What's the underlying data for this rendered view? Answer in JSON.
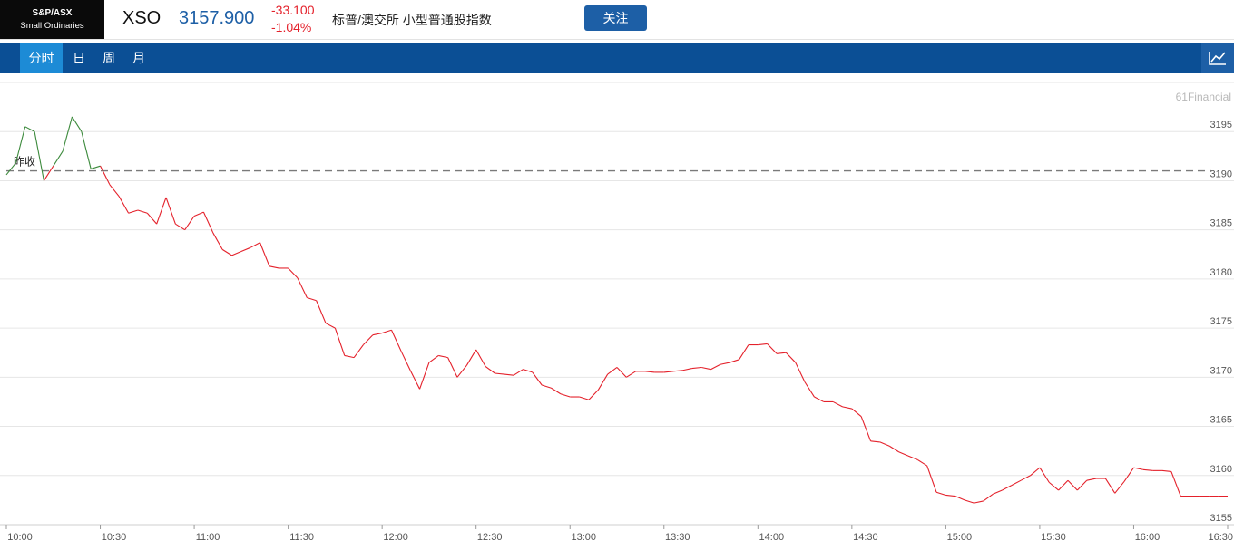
{
  "header": {
    "logo_line1": "S&P/ASX",
    "logo_line2": "Small Ordinaries",
    "symbol": "XSO",
    "price": "3157.900",
    "change": "-33.100",
    "change_pct": "-1.04%",
    "name": "标普/澳交所 小型普通股指数",
    "follow_label": "关注"
  },
  "tabs": [
    {
      "label": "分时",
      "active": true
    },
    {
      "label": "日",
      "active": false
    },
    {
      "label": "周",
      "active": false
    },
    {
      "label": "月",
      "active": false
    }
  ],
  "icons": {
    "chart_toggle": "line-chart-icon"
  },
  "colors": {
    "up": "#3c8a3c",
    "down": "#e4212b",
    "nav": "#0b4f95",
    "tab_active": "#1d8bd6",
    "price": "#1d5fa6"
  },
  "chart_data": {
    "type": "line",
    "watermark": "61Financial",
    "prev_close_label": "昨收",
    "prev_close": 3191.0,
    "ylim": [
      3155,
      3200
    ],
    "yticks": [
      3155,
      3160,
      3165,
      3170,
      3175,
      3180,
      3185,
      3190,
      3195
    ],
    "xticks": [
      "10:00",
      "10:30",
      "11:00",
      "11:30",
      "12:00",
      "12:30",
      "13:00",
      "13:30",
      "14:00",
      "14:30",
      "15:00",
      "15:30",
      "16:00",
      "16:30"
    ],
    "grid": true,
    "x": [
      "10:00",
      "10:03",
      "10:06",
      "10:09",
      "10:12",
      "10:15",
      "10:18",
      "10:21",
      "10:24",
      "10:27",
      "10:30",
      "10:33",
      "10:36",
      "10:39",
      "10:42",
      "10:45",
      "10:48",
      "10:51",
      "10:54",
      "10:57",
      "11:00",
      "11:03",
      "11:06",
      "11:09",
      "11:12",
      "11:15",
      "11:18",
      "11:21",
      "11:24",
      "11:27",
      "11:30",
      "11:33",
      "11:36",
      "11:39",
      "11:42",
      "11:45",
      "11:48",
      "11:51",
      "11:54",
      "11:57",
      "12:00",
      "12:03",
      "12:06",
      "12:09",
      "12:12",
      "12:15",
      "12:18",
      "12:21",
      "12:24",
      "12:27",
      "12:30",
      "12:33",
      "12:36",
      "12:39",
      "12:42",
      "12:45",
      "12:48",
      "12:51",
      "12:54",
      "12:57",
      "13:00",
      "13:03",
      "13:06",
      "13:09",
      "13:12",
      "13:15",
      "13:18",
      "13:21",
      "13:24",
      "13:27",
      "13:30",
      "13:33",
      "13:36",
      "13:39",
      "13:42",
      "13:45",
      "13:48",
      "13:51",
      "13:54",
      "13:57",
      "14:00",
      "14:03",
      "14:06",
      "14:09",
      "14:12",
      "14:15",
      "14:18",
      "14:21",
      "14:24",
      "14:27",
      "14:30",
      "14:33",
      "14:36",
      "14:39",
      "14:42",
      "14:45",
      "14:48",
      "14:51",
      "14:54",
      "14:57",
      "15:00",
      "15:03",
      "15:06",
      "15:09",
      "15:12",
      "15:15",
      "15:18",
      "15:21",
      "15:24",
      "15:27",
      "15:30",
      "15:33",
      "15:36",
      "15:39",
      "15:42",
      "15:45",
      "15:48",
      "15:51",
      "15:54",
      "15:57",
      "16:00",
      "16:03",
      "16:06",
      "16:09",
      "16:12",
      "16:15",
      "16:18",
      "16:21",
      "16:24",
      "16:27",
      "16:30"
    ],
    "series": [
      {
        "values": [
          3190.6,
          3191.8,
          3195.5,
          3195.0,
          3190.0,
          3191.5,
          3193.0,
          3196.5,
          3195.0,
          3191.2,
          3191.5,
          3189.6,
          3188.4,
          3186.7,
          3187.0,
          3186.7,
          3185.6,
          3188.3,
          3185.6,
          3185.0,
          3186.4,
          3186.8,
          3184.7,
          3183.0,
          3182.4,
          3182.8,
          3183.2,
          3183.7,
          3181.3,
          3181.1,
          3181.1,
          3180.1,
          3178.1,
          3177.8,
          3175.5,
          3175.0,
          3172.2,
          3172.0,
          3173.3,
          3174.3,
          3174.5,
          3174.8,
          3172.7,
          3170.7,
          3168.8,
          3171.5,
          3172.2,
          3172.0,
          3170.0,
          3171.2,
          3172.8,
          3171.1,
          3170.4,
          3170.3,
          3170.2,
          3170.8,
          3170.5,
          3169.2,
          3168.9,
          3168.3,
          3168.0,
          3168.0,
          3167.7,
          3168.7,
          3170.3,
          3171.0,
          3170.0,
          3170.6,
          3170.6,
          3170.5,
          3170.5,
          3170.6,
          3170.7,
          3170.9,
          3171.0,
          3170.8,
          3171.3,
          3171.5,
          3171.8,
          3173.3,
          3173.3,
          3173.4,
          3172.4,
          3172.5,
          3171.5,
          3169.5,
          3168.0,
          3167.5,
          3167.5,
          3167.0,
          3166.8,
          3166.0,
          3163.5,
          3163.4,
          3163.0,
          3162.4,
          3162.0,
          3161.6,
          3161.0,
          3158.3,
          3158.0,
          3157.9,
          3157.5,
          3157.2,
          3157.4,
          3158.1,
          3158.5,
          3159.0,
          3159.5,
          3160.0,
          3160.8,
          3159.3,
          3158.5,
          3159.5,
          3158.5,
          3159.5,
          3159.7,
          3159.7,
          3158.2,
          3159.4,
          3160.8,
          3160.6,
          3160.5,
          3160.5,
          3160.4,
          3157.9,
          3157.9,
          3157.9,
          3157.9,
          3157.9,
          3157.9
        ]
      }
    ]
  }
}
